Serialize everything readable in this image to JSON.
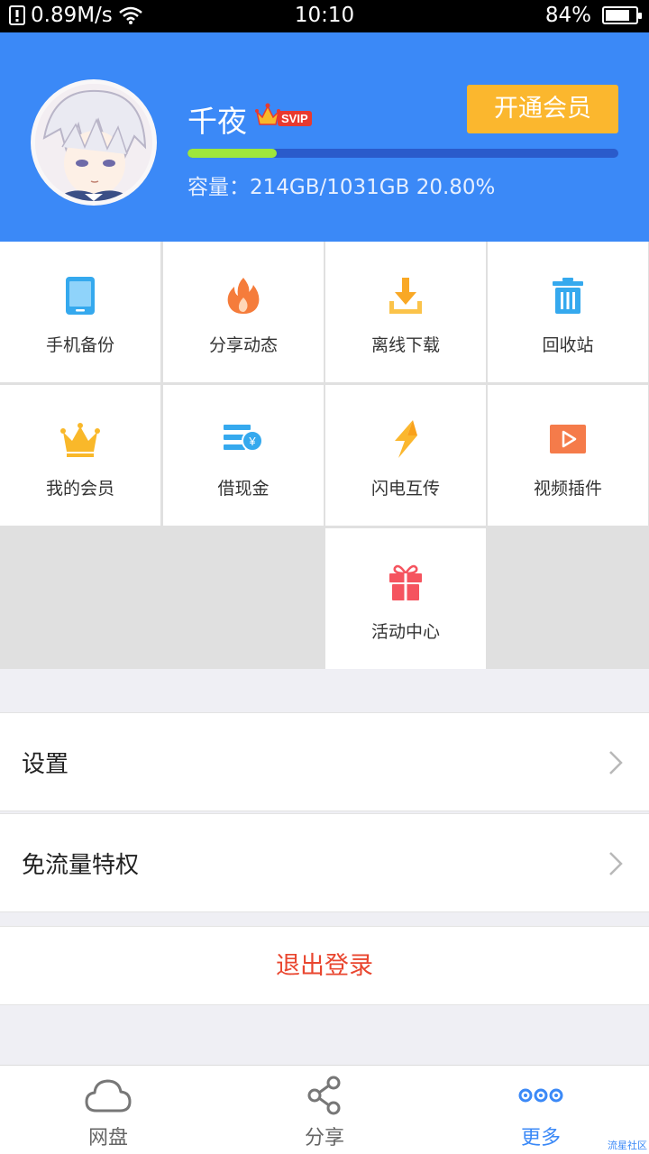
{
  "status_bar": {
    "speed": "0.89M/s",
    "time": "10:10",
    "battery": "84%",
    "battery_level": 0.84
  },
  "profile": {
    "username": "千夜",
    "vip_tag": "SVIP",
    "vip_button": "开通会员",
    "storage_text": "容量：214GB/1031GB 20.80%",
    "storage_used_fraction": 0.208
  },
  "grid": [
    {
      "label": "手机备份",
      "icon": "phone-icon"
    },
    {
      "label": "分享动态",
      "icon": "flame-icon"
    },
    {
      "label": "离线下载",
      "icon": "download-icon"
    },
    {
      "label": "回收站",
      "icon": "trash-icon"
    },
    {
      "label": "我的会员",
      "icon": "crown-icon"
    },
    {
      "label": "借现金",
      "icon": "cash-icon"
    },
    {
      "label": "闪电互传",
      "icon": "lightning-icon"
    },
    {
      "label": "视频插件",
      "icon": "video-icon"
    },
    {
      "label": "活动中心",
      "icon": "gift-icon"
    }
  ],
  "list": [
    {
      "label": "设置"
    },
    {
      "label": "免流量特权"
    }
  ],
  "logout": "退出登录",
  "tabs": [
    {
      "label": "网盘",
      "icon": "cloud-icon",
      "active": false
    },
    {
      "label": "分享",
      "icon": "share-icon",
      "active": false
    },
    {
      "label": "更多",
      "icon": "more-icon",
      "active": true
    }
  ],
  "watermark": "流星社区",
  "colors": {
    "primary": "#3b89f7",
    "vip": "#fbb72e",
    "danger": "#e9462f",
    "progress": "#9fe73b"
  }
}
